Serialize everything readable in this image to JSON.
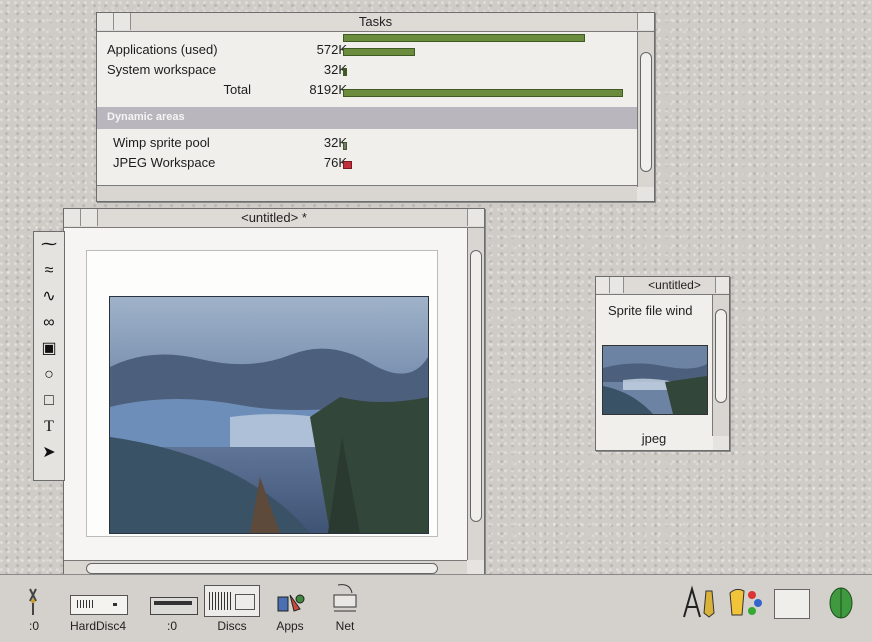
{
  "tasks_window": {
    "title": "Tasks",
    "rows": [
      {
        "label": "Applications (used)",
        "value": "572K"
      },
      {
        "label": "System workspace",
        "value": "32K"
      },
      {
        "label": "Total",
        "value": "8192K"
      }
    ],
    "section_header": "Dynamic areas",
    "dynamic_rows": [
      {
        "label": "Wimp sprite pool",
        "value": "32K"
      },
      {
        "label": "JPEG Workspace",
        "value": "76K"
      }
    ]
  },
  "draw_window": {
    "title": "<untitled> *"
  },
  "sprite_window": {
    "title": "<untitled>",
    "text": "Sprite file wind",
    "sprite_label": "jpeg"
  },
  "toolbox": {
    "tools": [
      "line-tool-icon",
      "curve-tool-icon",
      "move-tool-icon",
      "freehand-tool-icon",
      "rectangle-double-icon",
      "ellipse-tool-icon",
      "rectangle-tool-icon",
      "text-tool-icon",
      "select-arrow-icon"
    ]
  },
  "iconbar": {
    "items": [
      {
        "label": ":0",
        "icon": "floppy-disc-icon"
      },
      {
        "label": "HardDisc4",
        "icon": "hard-disc-icon"
      },
      {
        "label": ":0",
        "icon": "ram-disc-icon"
      },
      {
        "label": "Discs",
        "icon": "discs-icon"
      },
      {
        "label": "Apps",
        "icon": "apps-icon"
      },
      {
        "label": "Net",
        "icon": "network-icon"
      }
    ],
    "right_icons": [
      "draw-app-icon",
      "paint-app-icon",
      "display-icon",
      "acorn-logo-icon"
    ]
  },
  "colors": {
    "bar_green": "#6b8c3c",
    "jpeg_bar": "#c0303a",
    "selection": "#b9b6bd"
  }
}
